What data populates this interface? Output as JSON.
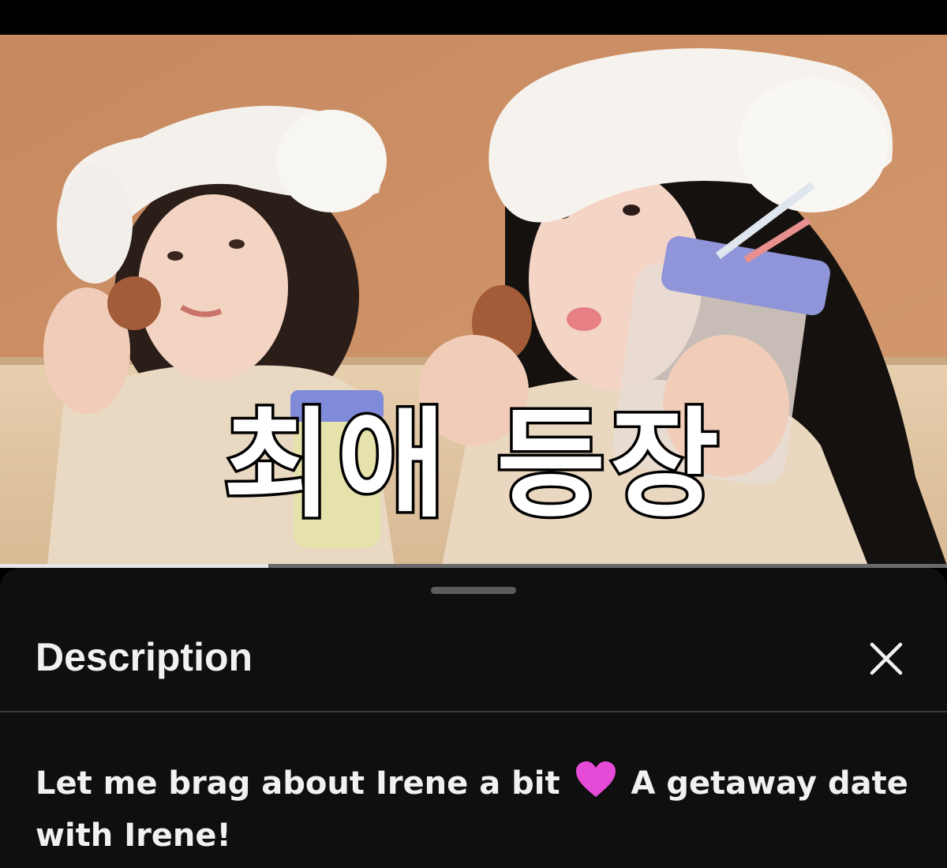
{
  "video": {
    "overlay_title": "최애 등장",
    "progress": 0.283
  },
  "sheet": {
    "title": "Description",
    "close_icon": "close-icon",
    "description_part1": "Let me brag about Irene a bit",
    "description_emoji": "pink-heart-icon",
    "description_part2": "A getaway date with Irene!"
  },
  "colors": {
    "sheet_bg": "#0f0f0f",
    "text": "#f1f1f1",
    "heart": "#e64bd7"
  }
}
